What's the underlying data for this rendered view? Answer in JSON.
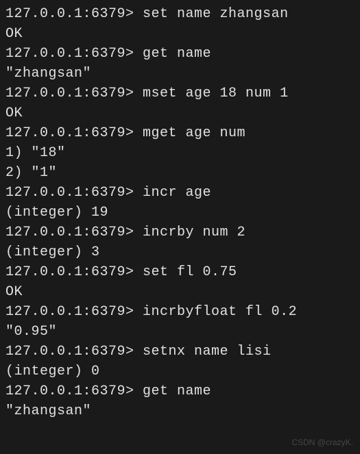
{
  "terminal": {
    "prompt": "127.0.0.1:6379>",
    "lines": [
      {
        "type": "cmd",
        "text": "set name zhangsan"
      },
      {
        "type": "out",
        "text": "OK"
      },
      {
        "type": "cmd",
        "text": "get name"
      },
      {
        "type": "out",
        "text": "\"zhangsan\""
      },
      {
        "type": "cmd",
        "text": "mset age 18 num 1"
      },
      {
        "type": "out",
        "text": "OK"
      },
      {
        "type": "cmd",
        "text": "mget age num"
      },
      {
        "type": "out",
        "text": "1) \"18\""
      },
      {
        "type": "out",
        "text": "2) \"1\""
      },
      {
        "type": "cmd",
        "text": "incr age"
      },
      {
        "type": "out",
        "text": "(integer) 19"
      },
      {
        "type": "cmd",
        "text": "incrby num 2"
      },
      {
        "type": "out",
        "text": "(integer) 3"
      },
      {
        "type": "cmd",
        "text": "set fl 0.75"
      },
      {
        "type": "out",
        "text": "OK"
      },
      {
        "type": "cmd",
        "text": "incrbyfloat fl 0.2"
      },
      {
        "type": "out",
        "text": "\"0.95\""
      },
      {
        "type": "cmd",
        "text": "setnx name lisi"
      },
      {
        "type": "out",
        "text": "(integer) 0"
      },
      {
        "type": "cmd",
        "text": "get name"
      },
      {
        "type": "out",
        "text": "\"zhangsan\""
      }
    ]
  },
  "watermark": "CSDN @crazyK."
}
